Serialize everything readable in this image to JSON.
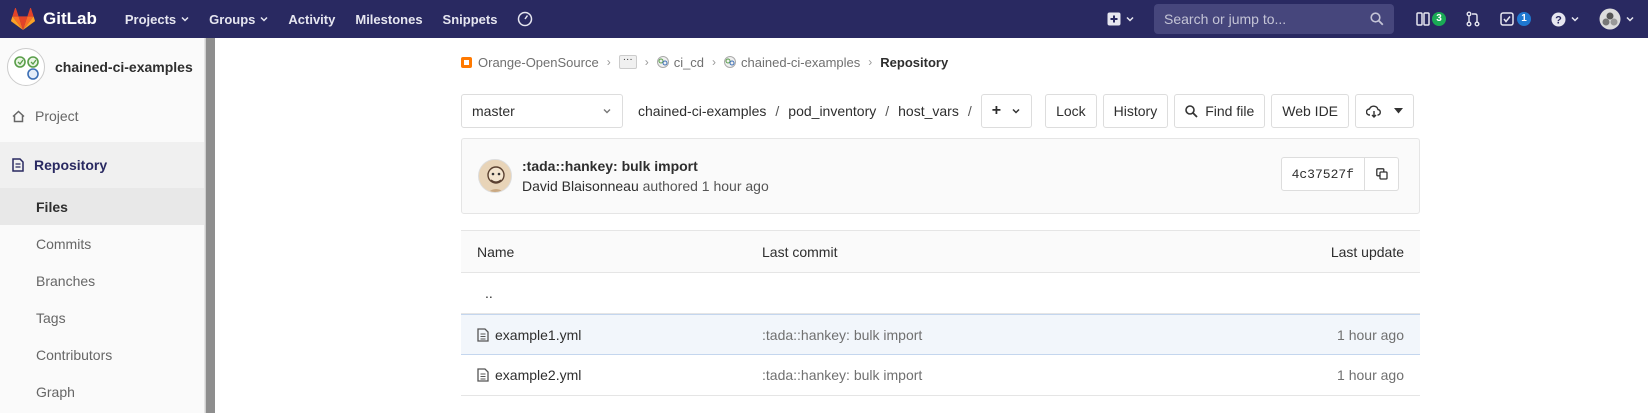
{
  "navbar": {
    "brand": "GitLab",
    "items": [
      {
        "label": "Projects",
        "caret": true
      },
      {
        "label": "Groups",
        "caret": true
      },
      {
        "label": "Activity",
        "caret": false
      },
      {
        "label": "Milestones",
        "caret": false
      },
      {
        "label": "Snippets",
        "caret": false
      }
    ],
    "search_placeholder": "Search or jump to...",
    "issues_count": "3",
    "todos_count": "1",
    "colors": {
      "bg": "#292961",
      "issues_badge": "#1aaa55",
      "todos_badge": "#1f78d1"
    }
  },
  "sidebar": {
    "project_name": "chained-ci-examples",
    "items": [
      {
        "label": "Project",
        "icon": "home-icon"
      },
      {
        "label": "Repository",
        "icon": "document-icon"
      }
    ],
    "subitems": [
      "Files",
      "Commits",
      "Branches",
      "Tags",
      "Contributors",
      "Graph"
    ],
    "active_subitem": "Files"
  },
  "breadcrumb": {
    "items": [
      "Orange-OpenSource",
      "ci_cd",
      "chained-ci-examples"
    ],
    "current": "Repository"
  },
  "tree": {
    "branch": "master",
    "path": [
      "chained-ci-examples",
      "pod_inventory",
      "host_vars"
    ],
    "add_label": "+",
    "buttons": {
      "lock": "Lock",
      "history": "History",
      "find_file": "Find file",
      "web_ide": "Web IDE"
    }
  },
  "last_commit": {
    "title": ":tada::hankey: bulk import",
    "author": "David Blaisonneau",
    "meta": "authored 1 hour ago",
    "sha": "4c37527f"
  },
  "files": {
    "headers": {
      "name": "Name",
      "commit": "Last commit",
      "update": "Last update"
    },
    "parent": "..",
    "rows": [
      {
        "name": "example1.yml",
        "commit": ":tada::hankey: bulk import",
        "update": "1 hour ago"
      },
      {
        "name": "example2.yml",
        "commit": ":tada::hankey: bulk import",
        "update": "1 hour ago"
      }
    ]
  }
}
